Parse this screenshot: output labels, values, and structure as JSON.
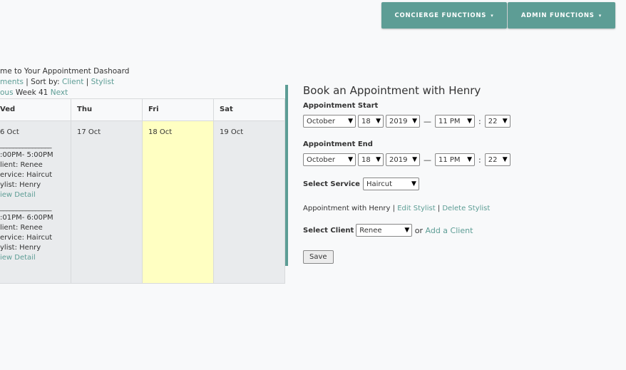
{
  "nav": {
    "concierge_label": "CONCIERGE FUNCTIONS",
    "admin_label": "ADMIN FUNCTIONS",
    "caret": "▾"
  },
  "welcome": {
    "text": "me to Your Appointment Dashoard",
    "appointments_link": "ments",
    "sort_text": " | Sort by: ",
    "client_link": "Client",
    "sep": " | ",
    "stylist_link": "Stylist",
    "prev_link": "ous",
    "week_text": " Week 41 ",
    "next_link": "Next"
  },
  "calendar": {
    "headers": [
      "Ved",
      "Thu",
      "Fri",
      "Sat"
    ],
    "wed": {
      "date": "6 Oct",
      "events": [
        {
          "sep": "________________",
          "time": ":00PM- 5:00PM",
          "client": "lient: Renee",
          "service": "ervice: Haircut",
          "stylist": "ylist: Henry",
          "link": "iew Detail"
        },
        {
          "sep": "________________",
          "time": ":01PM- 6:00PM",
          "client": "lient: Renee",
          "service": "ervice: Haircut",
          "stylist": "ylist: Henry",
          "link": "iew Detail"
        }
      ]
    },
    "thu_date": "17 Oct",
    "fri_date": "18 Oct",
    "sat_date": "19 Oct"
  },
  "booking": {
    "title": "Book an Appointment with Henry",
    "start_label": "Appointment Start",
    "end_label": "Appointment End",
    "start": {
      "month": "October",
      "day": "18",
      "year": "2019",
      "hour": "11 PM",
      "minute": "22"
    },
    "end": {
      "month": "October",
      "day": "18",
      "year": "2019",
      "hour": "11 PM",
      "minute": "22"
    },
    "dash": "—",
    "colon": ":",
    "arrow": "▼",
    "service_label": "Select Service",
    "service_value": "Haircut",
    "appt_with": "Appointment with Henry",
    "pipe": " | ",
    "edit_stylist": "Edit Stylist",
    "delete_stylist": "Delete Stylist",
    "client_label": "Select Client",
    "client_value": "Renee",
    "or_text": " or ",
    "add_client": "Add a Client",
    "save_label": "Save"
  }
}
